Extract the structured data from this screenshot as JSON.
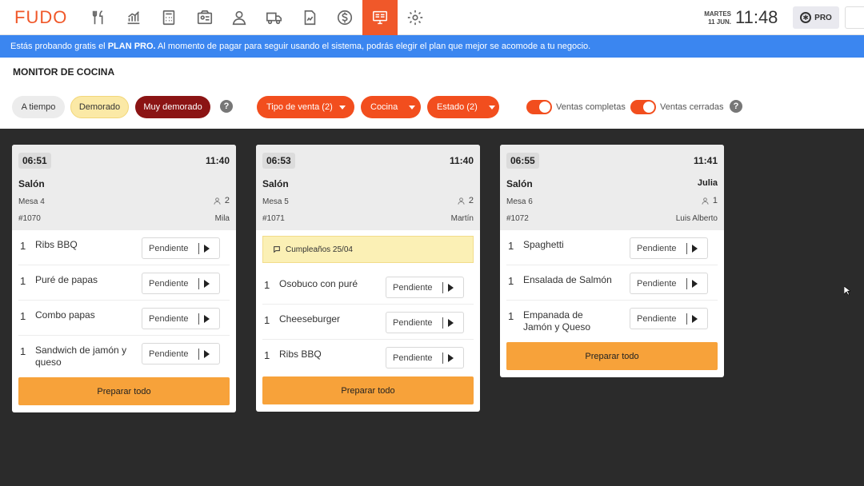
{
  "app": {
    "logo": "FUDO",
    "date_line1": "MARTES",
    "date_line2": "11 JUN.",
    "clock": "11:48",
    "plan_badge": "PRO"
  },
  "nav": [
    {
      "icon": "utensils-icon"
    },
    {
      "icon": "bar-chart-icon"
    },
    {
      "icon": "calculator-icon"
    },
    {
      "icon": "box-icon"
    },
    {
      "icon": "user-icon"
    },
    {
      "icon": "truck-icon"
    },
    {
      "icon": "report-icon"
    },
    {
      "icon": "dollar-icon"
    },
    {
      "icon": "kitchen-monitor-icon",
      "active": true
    },
    {
      "icon": "gear-icon"
    }
  ],
  "banner": {
    "part1": "Estás probando gratis el ",
    "plan": "PLAN PRO.",
    "part2": " Al momento de pagar para seguir usando el sistema, podrás elegir el plan que mejor se acomode a tu negocio."
  },
  "header": {
    "title": "MONITOR DE COCINA",
    "chips": {
      "on_time": "A tiempo",
      "delayed": "Demorado",
      "very_delayed": "Muy demorado"
    },
    "help": "?",
    "filters": {
      "sale_type": "Tipo de venta (2)",
      "kitchen": "Cocina",
      "status": "Estado (2)"
    },
    "toggles": {
      "completed": "Ventas completas",
      "closed": "Ventas cerradas"
    }
  },
  "cards": [
    {
      "elapsed": "06:51",
      "time": "11:40",
      "sector": "Salón",
      "waiter_top": "",
      "table": "Mesa 4",
      "guests": "2",
      "order": "#1070",
      "waiter": "Mila",
      "note": "",
      "items": [
        {
          "qty": "1",
          "name": "Ribs BBQ",
          "status": "Pendiente"
        },
        {
          "qty": "1",
          "name": "Puré de papas",
          "status": "Pendiente"
        },
        {
          "qty": "1",
          "name": "Combo papas",
          "status": "Pendiente"
        },
        {
          "qty": "1",
          "name": "Sandwich de jamón y queso",
          "status": "Pendiente"
        }
      ],
      "action": "Preparar todo"
    },
    {
      "elapsed": "06:53",
      "time": "11:40",
      "sector": "Salón",
      "waiter_top": "",
      "table": "Mesa 5",
      "guests": "2",
      "order": "#1071",
      "waiter": "Martín",
      "note": "Cumpleaños 25/04",
      "items": [
        {
          "qty": "1",
          "name": "Osobuco con puré",
          "status": "Pendiente"
        },
        {
          "qty": "1",
          "name": "Cheeseburger",
          "status": "Pendiente"
        },
        {
          "qty": "1",
          "name": "Ribs BBQ",
          "status": "Pendiente"
        }
      ],
      "action": "Preparar todo"
    },
    {
      "elapsed": "06:55",
      "time": "11:41",
      "sector": "Salón",
      "waiter_top": "Julia",
      "table": "Mesa 6",
      "guests": "1",
      "order": "#1072",
      "waiter": "Luis Alberto",
      "note": "",
      "items": [
        {
          "qty": "1",
          "name": "Spaghetti",
          "status": "Pendiente"
        },
        {
          "qty": "1",
          "name": "Ensalada de Salmón",
          "status": "Pendiente"
        },
        {
          "qty": "1",
          "name": "Empanada de Jamón y Queso",
          "status": "Pendiente"
        }
      ],
      "action": "Preparar todo"
    }
  ]
}
